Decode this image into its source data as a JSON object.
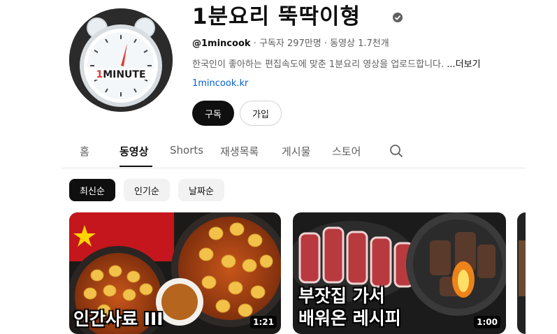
{
  "channel": {
    "name": "1분요리 뚝딱이형",
    "avatar_text": "1MINUTE",
    "handle": "@1mincook",
    "subscribers": "구독자 297만명",
    "videos": "동영상 1.7천개",
    "separator": "·",
    "description": "한국인이 좋아하는 편집속도에 맞춘 1분요리 영상을 업로드합니다.",
    "more_label": "...더보기",
    "link": "1mincook.kr",
    "subscribe_label": "구독",
    "join_label": "가입"
  },
  "tabs": [
    {
      "label": "홈",
      "active": false
    },
    {
      "label": "동영상",
      "active": true
    },
    {
      "label": "Shorts",
      "active": false
    },
    {
      "label": "재생목록",
      "active": false
    },
    {
      "label": "게시물",
      "active": false
    },
    {
      "label": "스토어",
      "active": false
    }
  ],
  "chips": [
    {
      "label": "최신순",
      "active": true
    },
    {
      "label": "인기순",
      "active": false
    },
    {
      "label": "날짜순",
      "active": false
    }
  ],
  "videos": [
    {
      "thumb_text": "인간사료 III",
      "duration": "1:21"
    },
    {
      "thumb_text_line1": "부잣집 가서",
      "thumb_text_line2": "배워온 레시피",
      "duration": "1:00"
    }
  ],
  "colors": {
    "text_primary": "#0f0f0f",
    "text_secondary": "#606060",
    "link": "#065fd4",
    "chip_bg": "#f2f2f2"
  },
  "icons": [
    "verified-icon",
    "search-icon"
  ]
}
